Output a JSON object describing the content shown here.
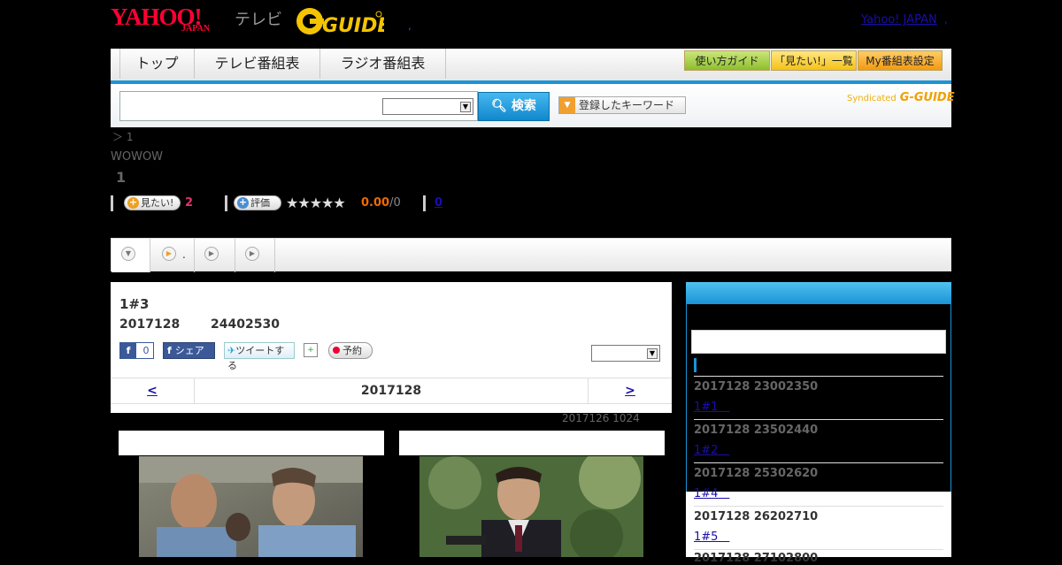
{
  "header": {
    "yahoo_logo": "YAHOO!",
    "yahoo_sub": "JAPAN",
    "tv_label": "テレビ",
    "gguide_logo": "G-GUIDE",
    "dot": ",",
    "yahoo_japan_link": "Yahoo! JAPAN",
    "top_link_sep": ","
  },
  "nav": {
    "tabs": [
      "トップ",
      "テレビ番組表",
      "ラジオ番組表"
    ],
    "guide_buttons": [
      "使い方ガイド",
      "「見たい!」一覧",
      "My番組表設定"
    ]
  },
  "search": {
    "button_label": "検索",
    "keyword_button": "登録したキーワード",
    "syndicated": "Syndicated",
    "gguide_small": "G-GUIDE"
  },
  "program": {
    "breadcrumb": "＞ 1",
    "station": "WOWOW",
    "title": "1",
    "want_label": "見たい!",
    "want_count": "2",
    "rate_label": "評価",
    "stars": "★★★★★",
    "score": "0.00",
    "score_count": "/0",
    "review_link": "0"
  },
  "tabs": {
    "tab2_label": "."
  },
  "episode": {
    "title": "1#3",
    "date": "2017128",
    "time": "24402530",
    "fb_like_count": "0",
    "fb_share": "シェア",
    "tweet": "ツイートする",
    "reserve": "予約",
    "nav_prev": "<",
    "nav_date": "2017128",
    "nav_next": ">",
    "updated": "2017126  1024"
  },
  "sidebar": {
    "items": [
      {
        "datetime": "2017128  23002350",
        "episode": "1#1　"
      },
      {
        "datetime": "2017128  23502440",
        "episode": "1#2　"
      },
      {
        "datetime": "2017128  25302620",
        "episode": "1#4　"
      },
      {
        "datetime": "2017128  26202710",
        "episode": "1#5　"
      },
      {
        "datetime": "2017128  27102800",
        "episode": ""
      }
    ]
  },
  "colors": {
    "accent_blue": "#1b94d6",
    "yahoo_red": "#ff0033",
    "want_pink": "#e0326e",
    "score_orange": "#f06a00"
  }
}
